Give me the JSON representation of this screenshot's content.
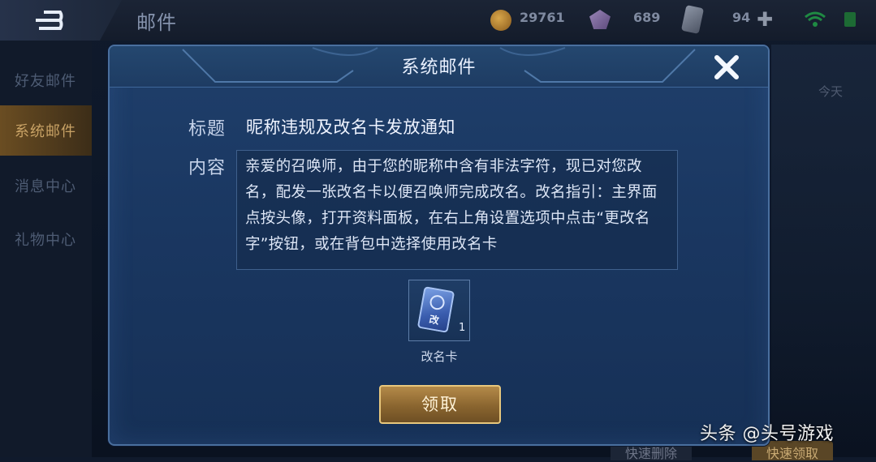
{
  "header": {
    "title": "邮件",
    "coins": "29761",
    "gems": "689",
    "tickets": "94"
  },
  "sidebar": {
    "items": [
      {
        "label": "好友邮件"
      },
      {
        "label": "系统邮件"
      },
      {
        "label": "消息中心"
      },
      {
        "label": "礼物中心"
      }
    ]
  },
  "mail_list": {
    "date": "今天"
  },
  "bottom": {
    "quick_delete": "快速删除",
    "quick_claim": "快速领取"
  },
  "dialog": {
    "title": "系统邮件",
    "subject_label": "标题",
    "subject": "昵称违规及改名卡发放通知",
    "content_label": "内容",
    "content": "亲爱的召唤师，由于您的昵称中含有非法字符，现已对您改名，配发一张改名卡以便召唤师完成改名。改名指引：主界面点按头像，打开资料面板，在右上角设置选项中点击“更改名字”按钮，或在背包中选择使用改名卡",
    "attachment": {
      "icon_text": "改",
      "quantity": "1",
      "name": "改名卡"
    },
    "claim_button": "领取"
  },
  "watermark": "头条 @头号游戏"
}
